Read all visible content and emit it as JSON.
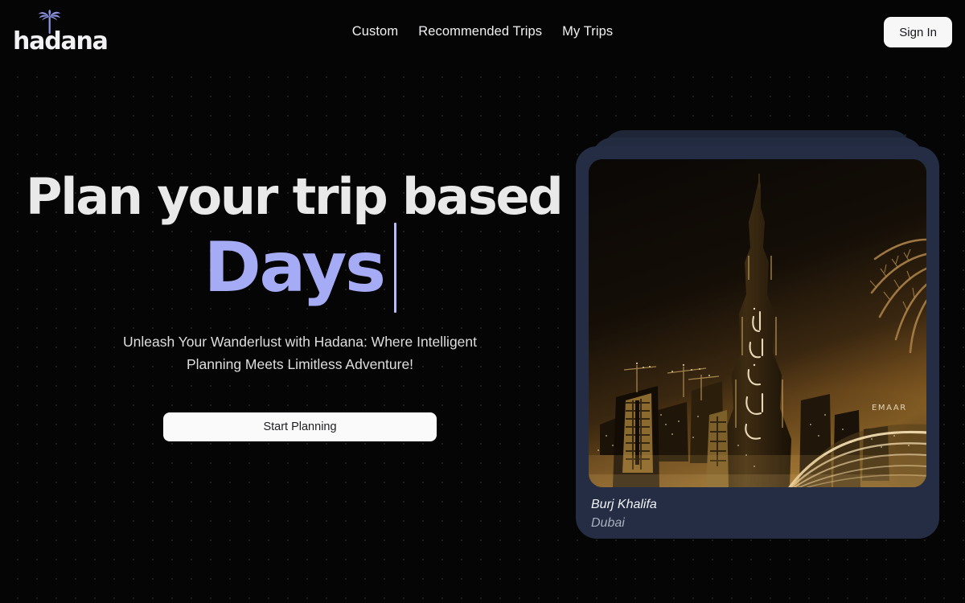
{
  "brand": {
    "name": "hadana",
    "logo_icon": "palm-tree-icon",
    "logo_color": "#8f96e8"
  },
  "header": {
    "nav": [
      {
        "label": "Custom"
      },
      {
        "label": "Recommended Trips"
      },
      {
        "label": "My Trips"
      }
    ],
    "signin_label": "Sign In"
  },
  "hero": {
    "headline_static": "Plan your trip based on",
    "headline_dynamic": "Days",
    "dynamic_color": "#a5abf5",
    "caret": "|",
    "subtitle": "Unleash Your Wanderlust with Hadana: Where Intelligent Planning Meets Limitless Adventure!",
    "cta_label": "Start Planning"
  },
  "destination_card": {
    "name": "Burj Khalifa",
    "location": "Dubai",
    "image_alt": "burj-khalifa-night-photo",
    "card_color": "#242d44",
    "stack_count": 3
  }
}
